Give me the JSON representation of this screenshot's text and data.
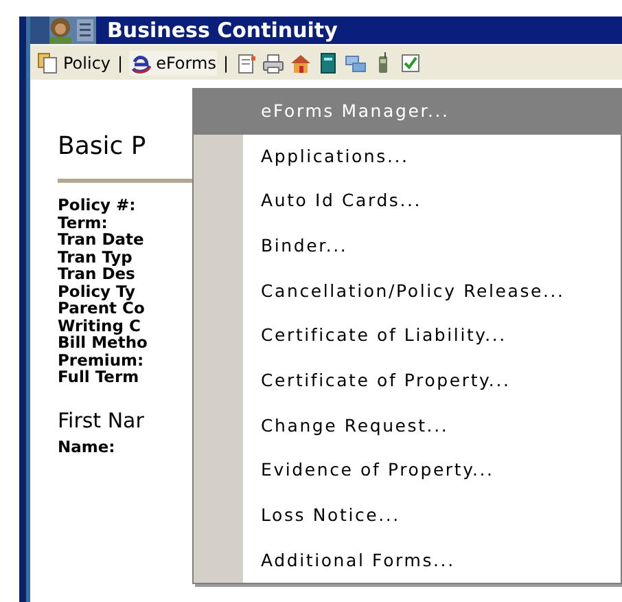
{
  "window": {
    "title": "Business Continuity"
  },
  "toolbar": {
    "items": [
      {
        "kind": "menu",
        "label": "Policy",
        "expanded": false
      },
      {
        "kind": "separator",
        "label": "|"
      },
      {
        "kind": "menu",
        "label": "eForms",
        "expanded": true
      },
      {
        "kind": "separator",
        "label": "|"
      }
    ]
  },
  "content": {
    "heading": "Basic P",
    "fields": [
      "Policy #:",
      "Term:",
      "Tran Date",
      "Tran Typ",
      "Tran Des",
      "Policy Ty",
      "Parent Co",
      "Writing C",
      "Bill Metho",
      "Premium:",
      "Full Term"
    ],
    "section": "First Nar",
    "next_label": "Name:"
  },
  "menu": {
    "items": [
      {
        "label": "eForms Manager...",
        "selected": true
      },
      {
        "label": "Applications...",
        "selected": false
      },
      {
        "label": "Auto Id Cards...",
        "selected": false
      },
      {
        "label": "Binder...",
        "selected": false
      },
      {
        "label": "Cancellation/Policy Release...",
        "selected": false
      },
      {
        "label": "Certificate of Liability...",
        "selected": false
      },
      {
        "label": "Certificate of Property...",
        "selected": false
      },
      {
        "label": "Change Request...",
        "selected": false
      },
      {
        "label": "Evidence of Property...",
        "selected": false
      },
      {
        "label": "Loss Notice...",
        "selected": false
      },
      {
        "label": "Additional Forms...",
        "selected": false
      }
    ]
  }
}
